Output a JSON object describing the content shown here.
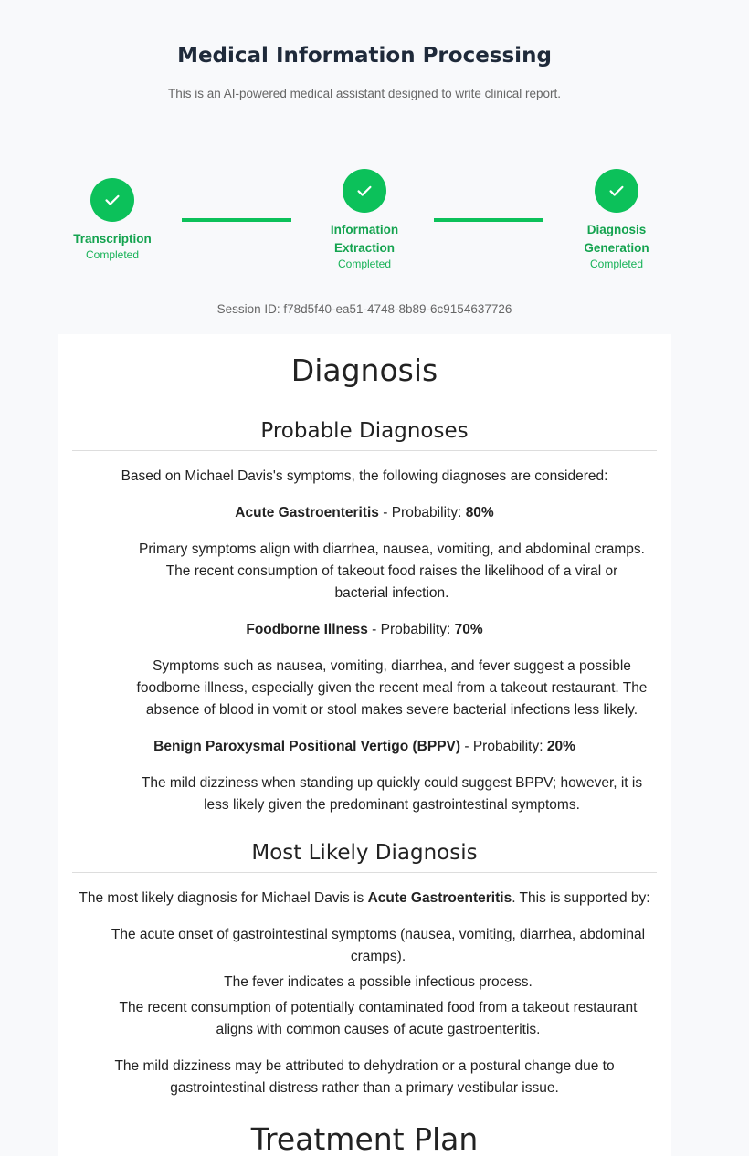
{
  "header": {
    "title": "Medical Information Processing",
    "subtitle": "This is an AI-powered medical assistant designed to write clinical report."
  },
  "steps": [
    {
      "label": "Transcription",
      "status": "Completed"
    },
    {
      "label_line1": "Information",
      "label_line2": "Extraction",
      "status": "Completed"
    },
    {
      "label_line1": "Diagnosis",
      "label_line2": "Generation",
      "status": "Completed"
    }
  ],
  "session": {
    "text": "Session ID: f78d5f40-ea51-4748-8b89-6c9154637726"
  },
  "report": {
    "heading": "Diagnosis",
    "probable": {
      "heading": "Probable Diagnoses",
      "intro": "Based on Michael Davis's symptoms, the following diagnoses are considered:",
      "items": [
        {
          "name": "Acute Gastroenteritis",
          "prob_label": " - Probability: ",
          "prob": "80%",
          "desc_lines": [
            "Primary symptoms align with diarrhea, nausea, vomiting, and abdominal cramps.",
            "The recent consumption of takeout food raises the likelihood of a viral or",
            "bacterial infection."
          ]
        },
        {
          "name": "Foodborne Illness",
          "prob_label": " - Probability: ",
          "prob": "70%",
          "desc_lines": [
            "Symptoms such as nausea, vomiting, diarrhea, and fever suggest a possible",
            "foodborne illness, especially given the recent meal from a takeout restaurant. The",
            "absence of blood in vomit or stool makes severe bacterial infections less likely."
          ]
        },
        {
          "name": "Benign Paroxysmal Positional Vertigo (BPPV)",
          "prob_label": " - Probability: ",
          "prob": "20%",
          "desc_lines": [
            "The mild dizziness when standing up quickly could suggest BPPV; however, it is",
            "less likely given the predominant gastrointestinal symptoms."
          ]
        }
      ]
    },
    "most_likely": {
      "heading": "Most Likely Diagnosis",
      "intro_pre": "The most likely diagnosis for Michael Davis is ",
      "intro_bold": "Acute Gastroenteritis",
      "intro_post": ". This is supported by:",
      "support": [
        [
          "The acute onset of gastrointestinal symptoms (nausea, vomiting, diarrhea, abdominal",
          "cramps)."
        ],
        [
          "The fever indicates a possible infectious process."
        ],
        [
          "The recent consumption of potentially contaminated food from a takeout restaurant",
          "aligns with common causes of acute gastroenteritis."
        ]
      ],
      "note_lines": [
        "The mild dizziness may be attributed to dehydration or a postural change due to",
        "gastrointestinal distress rather than a primary vestibular issue."
      ]
    },
    "next_heading": "Treatment Plan"
  }
}
